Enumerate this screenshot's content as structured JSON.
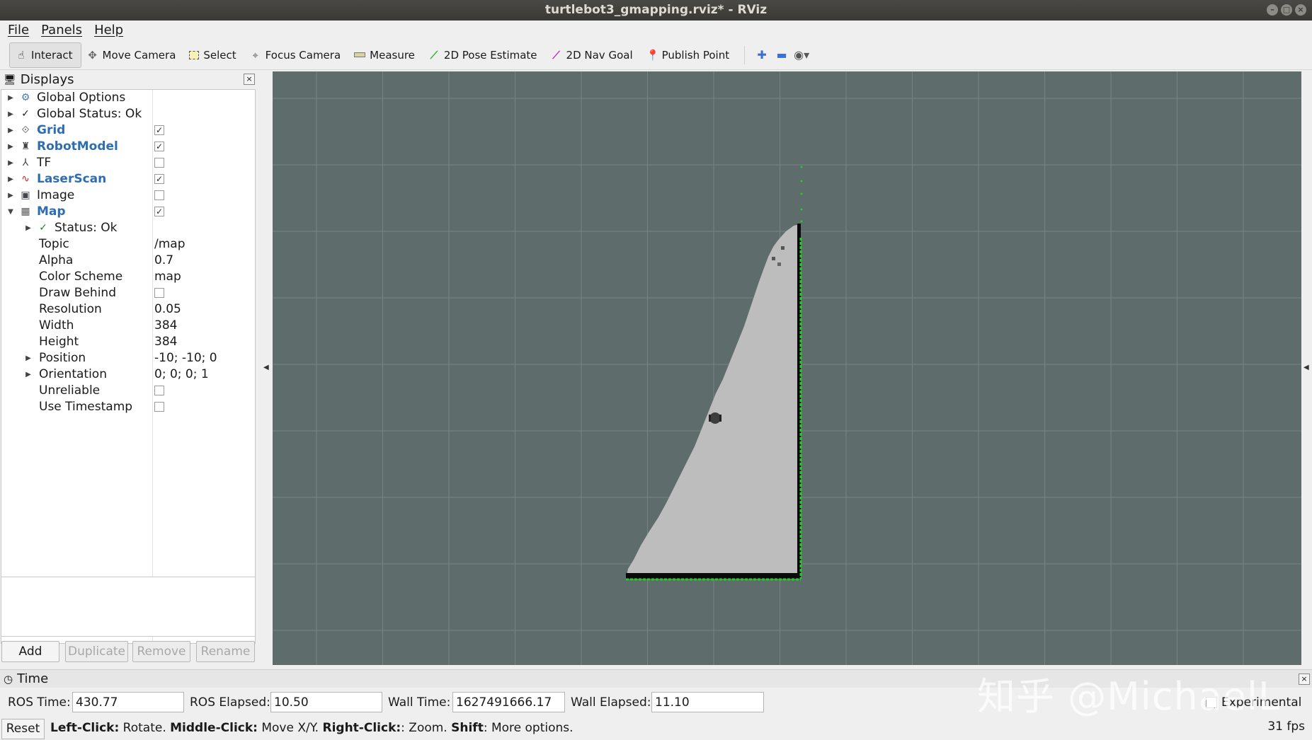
{
  "window": {
    "title": "turtlebot3_gmapping.rviz* - RViz"
  },
  "menubar": {
    "items": [
      "File",
      "Panels",
      "Help"
    ]
  },
  "toolbar": {
    "tools": [
      {
        "label": "Interact",
        "icon": "hand-icon",
        "active": true
      },
      {
        "label": "Move Camera",
        "icon": "move-camera-icon"
      },
      {
        "label": "Select",
        "icon": "select-icon"
      },
      {
        "label": "Focus Camera",
        "icon": "focus-camera-icon"
      },
      {
        "label": "Measure",
        "icon": "measure-icon"
      },
      {
        "label": "2D Pose Estimate",
        "icon": "pose-estimate-icon"
      },
      {
        "label": "2D Nav Goal",
        "icon": "nav-goal-icon"
      },
      {
        "label": "Publish Point",
        "icon": "publish-point-icon"
      }
    ]
  },
  "displays": {
    "title": "Displays",
    "tree": {
      "global_options": "Global Options",
      "global_status": "Global Status: Ok",
      "grid": "Grid",
      "robot_model": "RobotModel",
      "tf": "TF",
      "laser_scan": "LaserScan",
      "image": "Image",
      "map": "Map",
      "map_status": "Status: Ok",
      "topic_label": "Topic",
      "topic_value": "/map",
      "alpha_label": "Alpha",
      "alpha_value": "0.7",
      "color_scheme_label": "Color Scheme",
      "color_scheme_value": "map",
      "draw_behind_label": "Draw Behind",
      "resolution_label": "Resolution",
      "resolution_value": "0.05",
      "width_label": "Width",
      "width_value": "384",
      "height_label": "Height",
      "height_value": "384",
      "position_label": "Position",
      "position_value": "-10; -10; 0",
      "orientation_label": "Orientation",
      "orientation_value": "0; 0; 0; 1",
      "unreliable_label": "Unreliable",
      "use_timestamp_label": "Use Timestamp"
    },
    "checks": {
      "grid": true,
      "robot_model": true,
      "tf": false,
      "laser_scan": true,
      "image": false,
      "map": true,
      "draw_behind": false,
      "unreliable": false,
      "use_timestamp": false
    },
    "buttons": {
      "add": "Add",
      "duplicate": "Duplicate",
      "remove": "Remove",
      "rename": "Rename"
    }
  },
  "time": {
    "title": "Time",
    "ros_time_label": "ROS Time:",
    "ros_time": "430.77",
    "ros_elapsed_label": "ROS Elapsed:",
    "ros_elapsed": "10.50",
    "wall_time_label": "Wall Time:",
    "wall_time": "1627491666.17",
    "wall_elapsed_label": "Wall Elapsed:",
    "wall_elapsed": "11.10",
    "experimental_label": "Experimental"
  },
  "status": {
    "reset": "Reset",
    "hint_left_click": "Left-Click:",
    "hint_rotate": " Rotate. ",
    "hint_middle_click": "Middle-Click:",
    "hint_move": " Move X/Y. ",
    "hint_right_click": "Right-Click:",
    "hint_zoom": ": Zoom. ",
    "hint_shift": "Shift",
    "hint_more": ": More options.",
    "fps": "31 fps"
  },
  "watermark": "知乎 @MichaelL",
  "colors": {
    "viewport_bg": "#5f6c6c",
    "map_free": "#bdbdbd",
    "map_wall": "#0a0a0a",
    "laser": "#1fd11f",
    "accent_blue": "#2f6db3"
  }
}
